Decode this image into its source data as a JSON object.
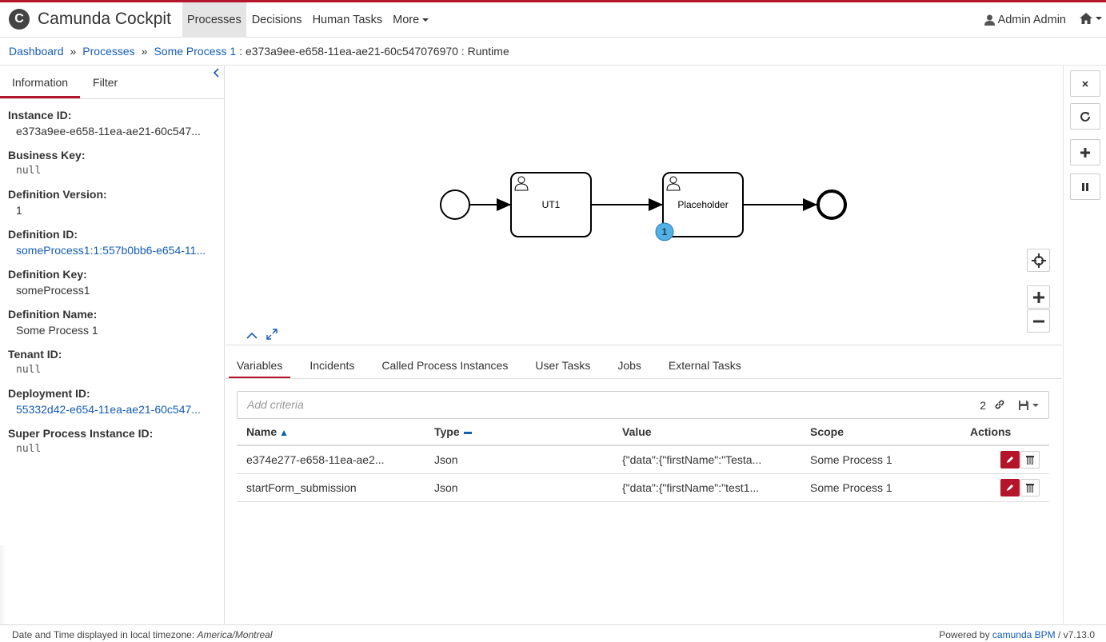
{
  "header": {
    "brand": "Camunda Cockpit",
    "nav": [
      "Processes",
      "Decisions",
      "Human Tasks",
      "More"
    ],
    "user": "Admin Admin"
  },
  "breadcrumb": {
    "dashboard": "Dashboard",
    "processes": "Processes",
    "process": "Some Process 1",
    "current": ": e373a9ee-e658-11ea-ae21-60c547076970 : Runtime"
  },
  "sidebar": {
    "tabs": [
      "Information",
      "Filter"
    ],
    "fields": [
      {
        "label": "Instance ID:",
        "value": "e373a9ee-e658-11ea-ae21-60c547..."
      },
      {
        "label": "Business Key:",
        "value": "null"
      },
      {
        "label": "Definition Version:",
        "value": "1"
      },
      {
        "label": "Definition ID:",
        "value": "someProcess1:1:557b0bb6-e654-11..."
      },
      {
        "label": "Definition Key:",
        "value": "someProcess1"
      },
      {
        "label": "Definition Name:",
        "value": "Some Process 1"
      },
      {
        "label": "Tenant ID:",
        "value": "null"
      },
      {
        "label": "Deployment ID:",
        "value": "55332d42-e654-11ea-ae21-60c547..."
      },
      {
        "label": "Super Process Instance ID:",
        "value": "null"
      }
    ]
  },
  "diagram": {
    "task1": "UT1",
    "task2": "Placeholder",
    "badge": "1"
  },
  "tabs": [
    "Variables",
    "Incidents",
    "Called Process Instances",
    "User Tasks",
    "Jobs",
    "External Tasks"
  ],
  "search": {
    "placeholder": "Add criteria",
    "count": "2"
  },
  "table": {
    "headers": [
      "Name",
      "Type",
      "Value",
      "Scope",
      "Actions"
    ],
    "rows": [
      {
        "name": "e374e277-e658-11ea-ae2...",
        "type": "Json",
        "value": "{\"data\":{\"firstName\":\"Testa...",
        "scope": "Some Process 1"
      },
      {
        "name": "startForm_submission",
        "type": "Json",
        "value": "{\"data\":{\"firstName\":\"test1...",
        "scope": "Some Process 1"
      }
    ]
  },
  "footer": {
    "left_prefix": "Date and Time displayed in local timezone: ",
    "timezone": "America/Montreal",
    "right_prefix": "Powered by ",
    "right_link": "camunda BPM",
    "version": " / v7.13.0"
  },
  "colors": {
    "accent": "#b5152b",
    "link": "#155cb5",
    "badge": "#52b0e5"
  }
}
